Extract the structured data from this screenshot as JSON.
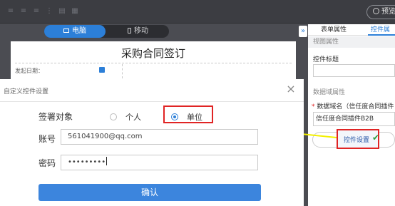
{
  "toolbar": {
    "icons": [
      "align-left-icon",
      "align-center-icon",
      "align-right-icon",
      "distribute-icon",
      "layer-icon",
      "grid-icon"
    ],
    "preview_label": "预览"
  },
  "device_switch": {
    "pc_label": "电脑",
    "mobile_label": "移动",
    "active": "pc"
  },
  "canvas": {
    "title": "采购合同签订",
    "date_label": "发起日期："
  },
  "collapse_handle": "»",
  "right_panel": {
    "tabs": [
      "表单属性",
      "控件属性"
    ],
    "active_tab": 1,
    "view_section": "视图属性",
    "control_title_label": "控件标题",
    "control_title_value": "",
    "domain_section": "数据域属性",
    "domain_name_label": "数据域名（信任度合同插件",
    "domain_name_value": "信任度合同插件B2B",
    "control_settings_label": "控件设置"
  },
  "dialog": {
    "title": "自定义控件设置",
    "close_label": "×",
    "signer_label": "签署对象",
    "options": [
      "个人",
      "单位"
    ],
    "selected_option": 1,
    "account_label": "账号",
    "account_value": "561041900@qq.com",
    "password_label": "密码",
    "password_value": "•••••••••",
    "confirm_label": "确认"
  },
  "colors": {
    "accent": "#2c7fd8",
    "highlight": "#e02424",
    "arrow": "#f3f000",
    "check": "#2e9e3e"
  }
}
